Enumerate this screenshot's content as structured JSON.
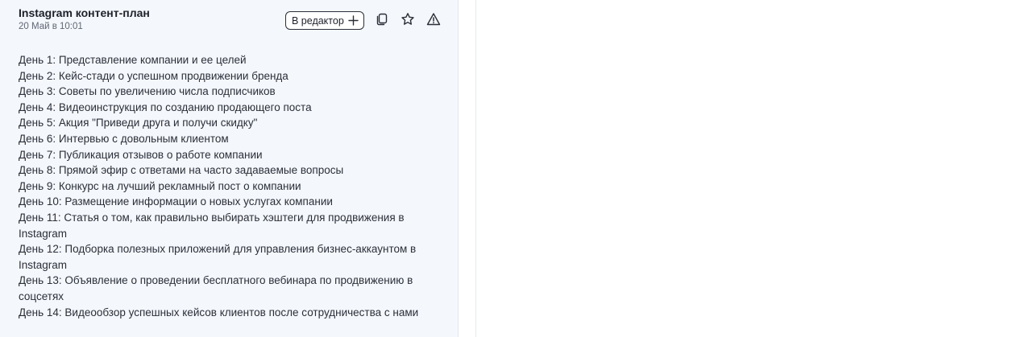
{
  "card": {
    "title": "Instagram контент-план",
    "date": "20 Май в 10:01",
    "editor_button_label": "В редактор",
    "icons": {
      "editor_plus": "plus-icon",
      "copy": "copy-icon",
      "favorite": "star-icon",
      "report": "warning-icon"
    },
    "items": [
      "День 1: Представление компании и ее целей",
      "День 2: Кейс-стади о успешном продвижении бренда",
      "День 3: Советы по увеличению числа подписчиков",
      "День 4: Видеоинструкция по созданию продающего поста",
      "День 5: Акция \"Приведи друга и получи скидку\"",
      "День 6: Интервью с довольным клиентом",
      "День 7: Публикация отзывов о работе компании",
      "День 8: Прямой эфир с ответами на часто задаваемые вопросы",
      "День 9: Конкурс на лучший рекламный пост о компании",
      "День 10: Размещение информации о новых услугах компании",
      "День 11: Статья о том, как правильно выбирать хэштеги для продвижения в Instagram",
      "День 12: Подборка полезных приложений для управления бизнес-аккаунтом в Instagram",
      "День 13: Объявление о проведении бесплатного вебинара по продвижению в соцсетях",
      "День 14: Видеообзор успешных кейсов клиентов после сотрудничества с нами"
    ]
  },
  "colors": {
    "card_background": "#f4f7fc",
    "text": "#2b2f38",
    "title": "#1e2129",
    "muted": "#606774"
  }
}
